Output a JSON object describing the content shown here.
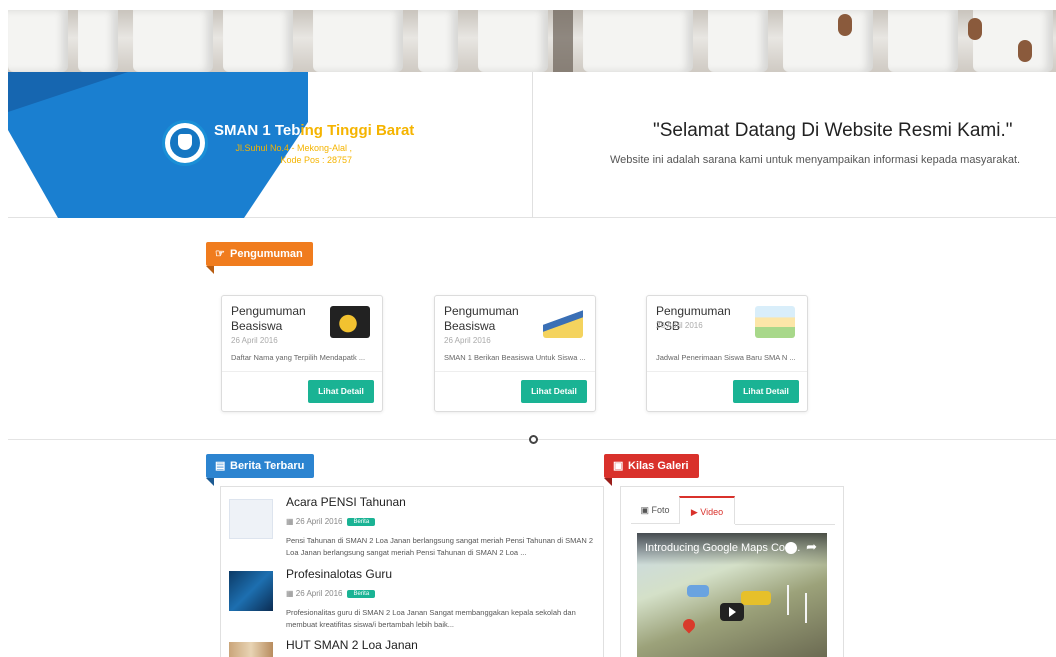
{
  "header": {
    "school_name_part1": "SMAN 1 Teb",
    "school_name_part2": "ing Tinggi Barat",
    "address_line1": "Jl.Suhul No.4 - Mekong-Alal ,",
    "address_line2": "Kode Pos : 28757",
    "welcome_title": "\"Selamat Datang Di Website Resmi Kami.\"",
    "welcome_subtitle": "Website ini adalah sarana kami untuk menyampaikan informasi kepada masyarakat."
  },
  "announcements": {
    "tag_label": "Pengumuman",
    "tag_icon": "megaphone-icon",
    "items": [
      {
        "title": "Pengumuman Beasiswa",
        "date": "26 April 2016",
        "excerpt": "Daftar Nama yang Terpilih Mendapatk ...",
        "button": "Lihat Detail"
      },
      {
        "title": "Pengumuman Beasiswa",
        "date": "26 April 2016",
        "excerpt": "SMAN 1 Berikan Beasiswa Untuk Siswa ...",
        "button": "Lihat Detail"
      },
      {
        "title": "Pengumuman PSB",
        "date": "26 April 2016",
        "excerpt": "Jadwal Penerimaan Siswa Baru SMA N ...",
        "button": "Lihat Detail"
      }
    ]
  },
  "news": {
    "tag_label": "Berita Terbaru",
    "tag_icon": "newspaper-icon",
    "items": [
      {
        "title": "Acara PENSI Tahunan",
        "date": "26 April 2016",
        "badge": "Berita",
        "excerpt": "Pensi Tahunan di SMAN 2 Loa Janan berlangsung sangat meriah Pensi Tahunan di SMAN 2 Loa Janan berlangsung sangat meriah Pensi Tahunan di SMAN 2 Loa ..."
      },
      {
        "title": "Profesinalotas Guru",
        "date": "26 April 2016",
        "badge": "Berita",
        "excerpt": "Profesionalitas guru di SMAN 2 Loa Janan Sangat membanggakan kepala sekolah dan membuat kreatifitas siswa/i bertambah lebih baik..."
      },
      {
        "title": "HUT SMAN 2 Loa Janan",
        "date": "",
        "badge": "",
        "excerpt": ""
      }
    ]
  },
  "gallery": {
    "tag_label": "Kilas Galeri",
    "tag_icon": "image-icon",
    "tabs": [
      {
        "label": "Foto",
        "icon": "photo-icon"
      },
      {
        "label": "Video",
        "icon": "play-icon"
      }
    ],
    "video_title": "Introducing Google Maps Coo..."
  },
  "colors": {
    "accent_orange": "#f07c1e",
    "accent_blue": "#2c84d0",
    "accent_red": "#d9312b",
    "button_green": "#1ab394",
    "school_name_yellow": "#f5b400",
    "ribbon_blue": "#1a7fd0"
  }
}
